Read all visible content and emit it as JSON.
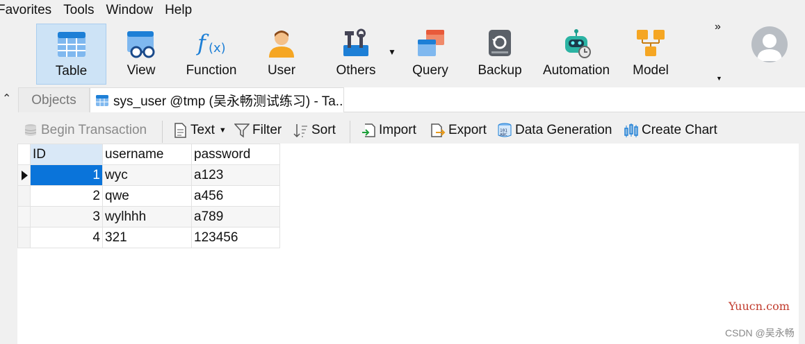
{
  "menu": [
    "Favorites",
    "Tools",
    "Window",
    "Help"
  ],
  "ribbon": {
    "tools": [
      {
        "label": "Table"
      },
      {
        "label": "View"
      },
      {
        "label": "Function"
      },
      {
        "label": "User"
      },
      {
        "label": "Others"
      },
      {
        "label": "Query"
      },
      {
        "label": "Backup"
      },
      {
        "label": "Automation"
      },
      {
        "label": "Model"
      }
    ],
    "overflow": "»"
  },
  "tabs": {
    "objects": "Objects",
    "active": "sys_user @tmp (吴永畅测试练习) - Ta..."
  },
  "toolbar": {
    "begin_transaction": "Begin Transaction",
    "text": "Text",
    "filter": "Filter",
    "sort": "Sort",
    "import": "Import",
    "export": "Export",
    "data_generation": "Data Generation",
    "create_chart": "Create Chart"
  },
  "grid": {
    "columns": [
      "ID",
      "username",
      "password"
    ],
    "rows": [
      [
        "1",
        "wyc",
        "a123"
      ],
      [
        "2",
        "qwe",
        "a456"
      ],
      [
        "3",
        "wylhhh",
        "a789"
      ],
      [
        "4",
        "321",
        "123456"
      ]
    ]
  },
  "watermarks": {
    "site": "Yuucn.com",
    "csdn": "CSDN @吴永畅"
  },
  "colors": {
    "selection": "#0a74da",
    "ribbon_active": "#cde3f6",
    "watermark": "#c0392b"
  }
}
